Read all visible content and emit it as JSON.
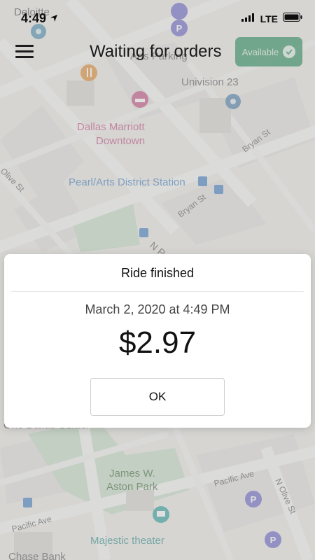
{
  "status_bar": {
    "carrier": "Deloitte",
    "time": "4:49",
    "network": "LTE"
  },
  "header": {
    "title": "Waiting for orders",
    "available_label": "Available"
  },
  "map": {
    "labels": {
      "parking": "Arts Parking",
      "univision": "Univision 23",
      "marriott_line1": "Dallas Marriott",
      "marriott_line2": "Downtown",
      "pearl_station": "Pearl/Arts District Station",
      "bryan_st_1": "Bryan St",
      "bryan_st_2": "Bryan St",
      "olive_st_1": "Olive St",
      "n_pearl": "N P",
      "one_dallas": "One Dallas Center",
      "aston_line1": "James W.",
      "aston_line2": "Aston Park",
      "pacific_1": "Pacific Ave",
      "pacific_2": "Pacific Ave",
      "olive_st_2": "N Olive St",
      "majestic": "Majestic theater",
      "chase": "Chase Bank"
    }
  },
  "dialog": {
    "title": "Ride finished",
    "date": "March 2, 2020 at 4:49 PM",
    "amount": "$2.97",
    "ok_label": "OK"
  },
  "colors": {
    "available_bg": "#6fb593",
    "map_blue": "#3f7fc2",
    "map_pink": "#c44f84",
    "map_teal": "#2aa19a",
    "park_green": "#c9dfc6"
  }
}
